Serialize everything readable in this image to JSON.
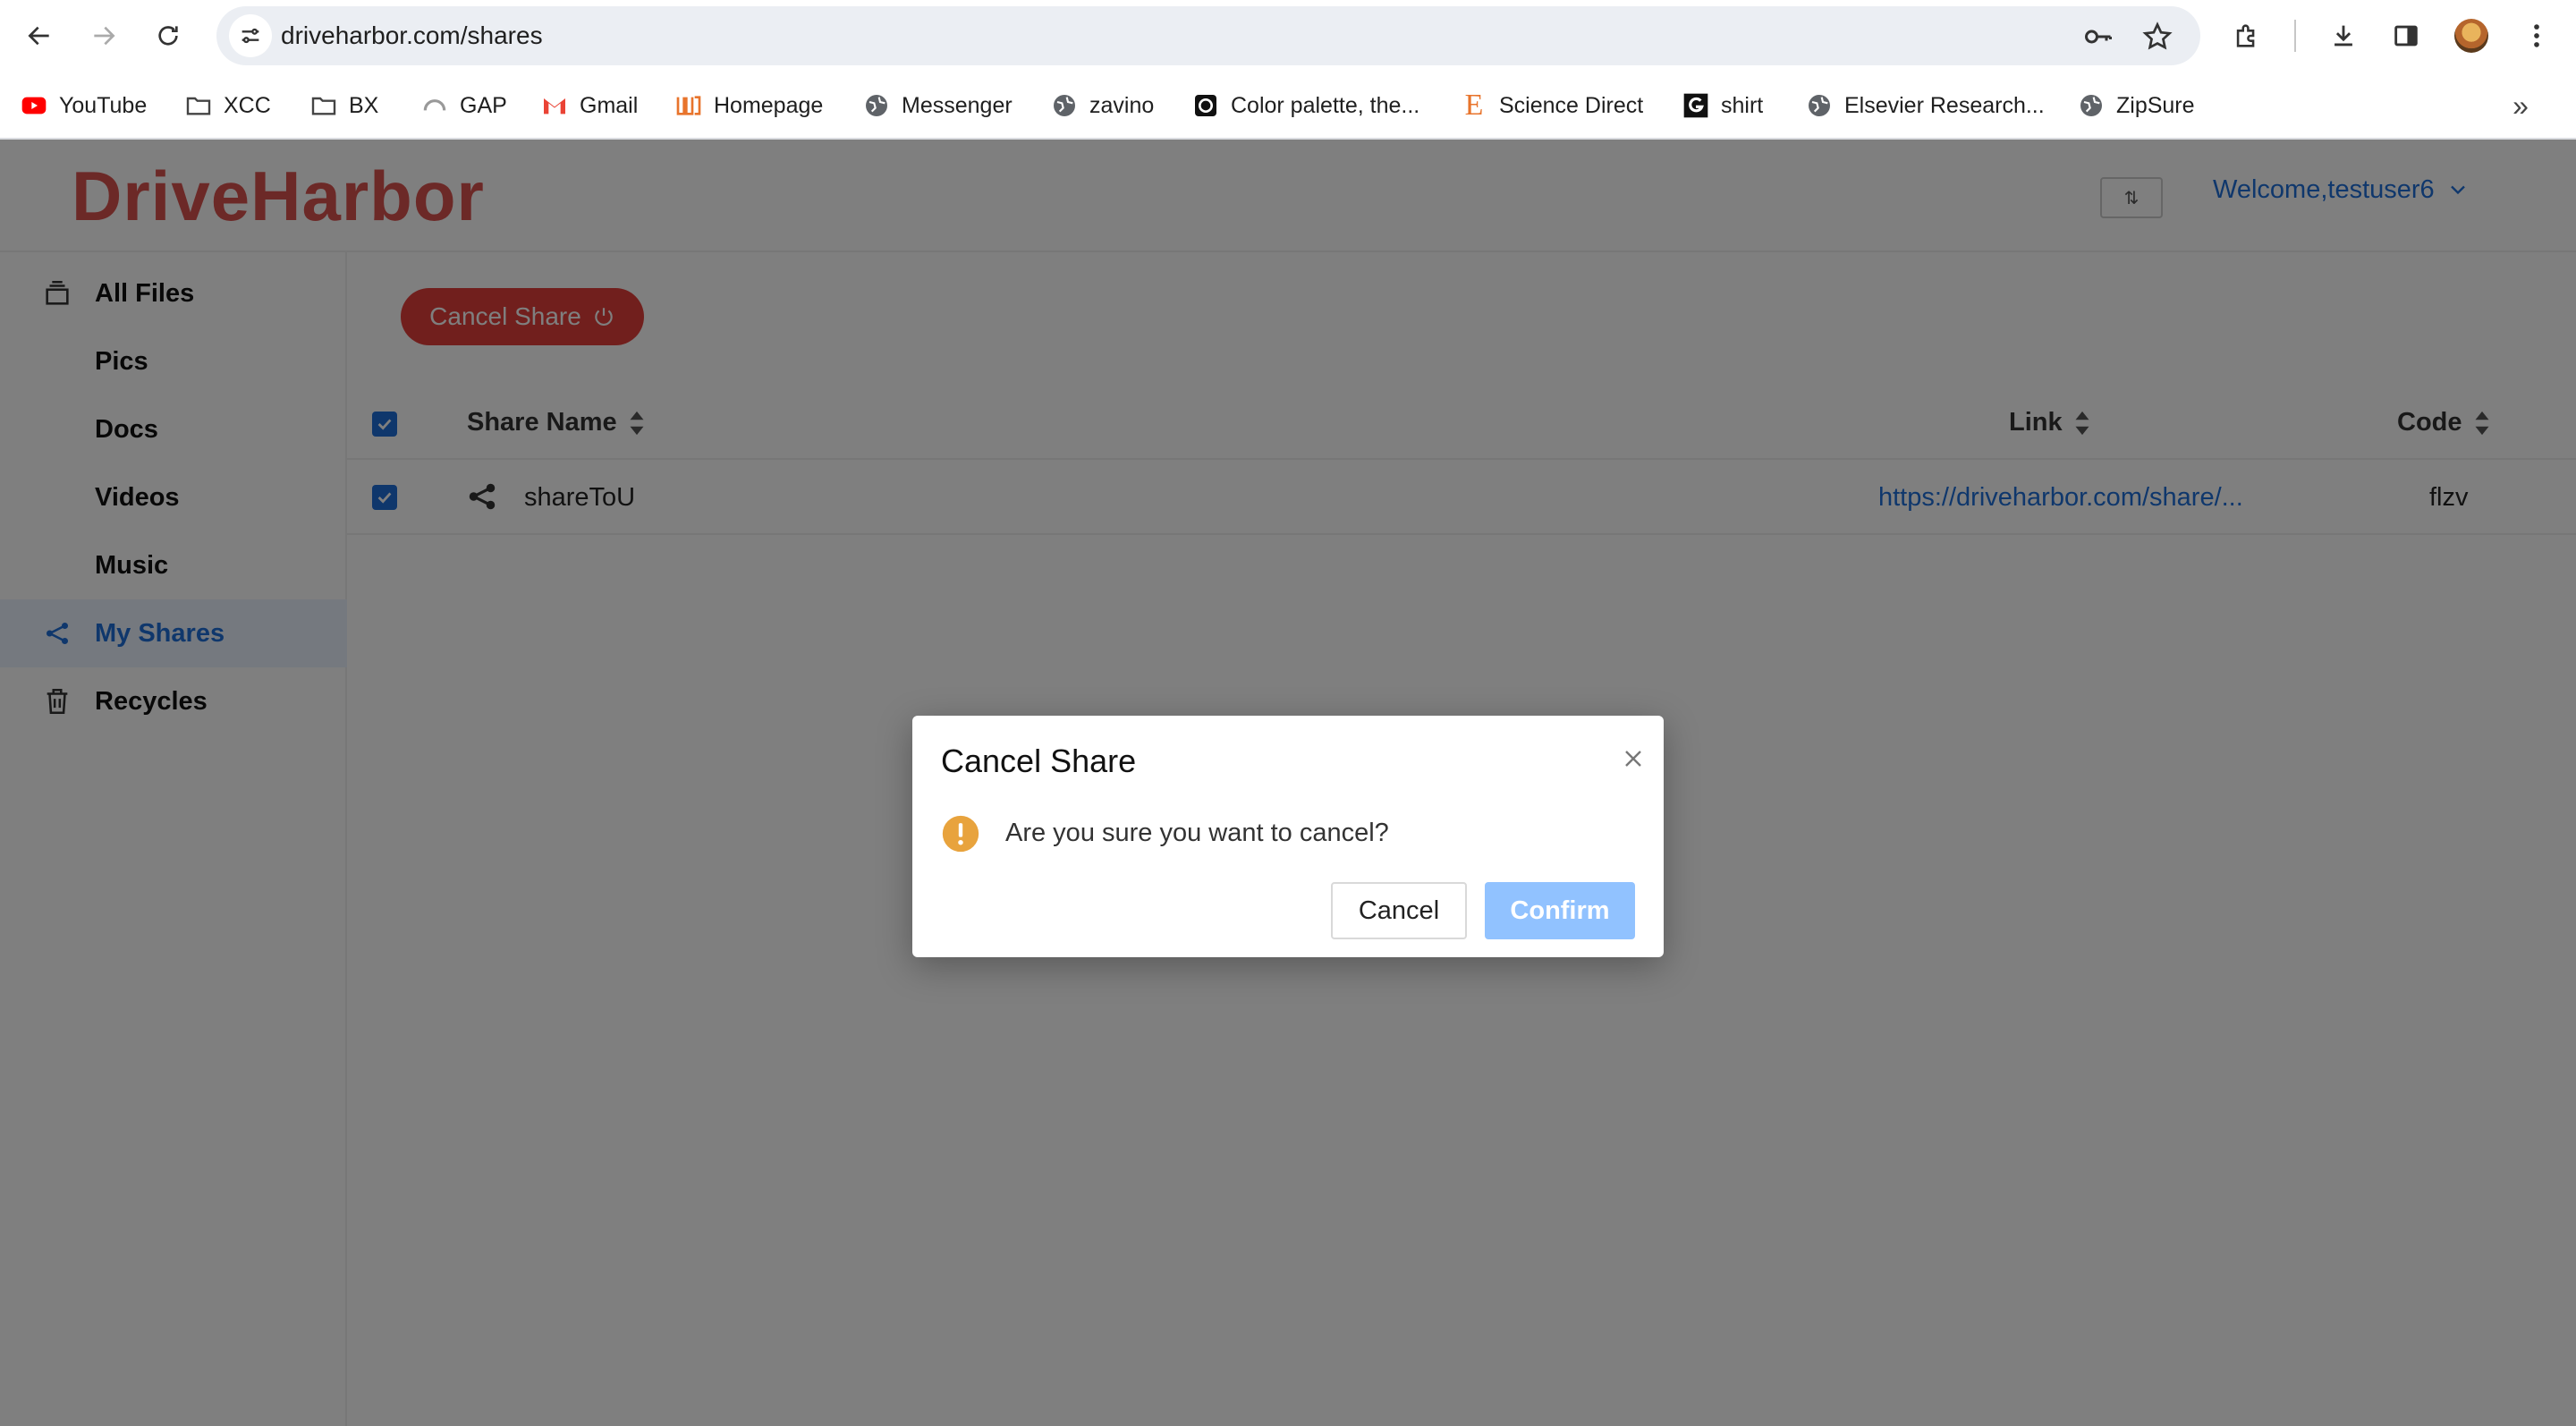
{
  "browser": {
    "url": "driveharbor.com/shares",
    "bookmarks": [
      {
        "label": "YouTube",
        "icon": "youtube-icon"
      },
      {
        "label": "XCC",
        "icon": "folder-icon"
      },
      {
        "label": "BX",
        "icon": "folder-icon"
      },
      {
        "label": "GAP",
        "icon": "gauge-icon"
      },
      {
        "label": "Gmail",
        "icon": "gmail-icon"
      },
      {
        "label": "Homepage",
        "icon": "homepage-icon"
      },
      {
        "label": "Messenger",
        "icon": "globe-icon"
      },
      {
        "label": "zavino",
        "icon": "globe-icon"
      },
      {
        "label": "Color palette, the...",
        "icon": "palette-icon"
      },
      {
        "label": "Science Direct",
        "icon": "elsevier-icon"
      },
      {
        "label": "shirt",
        "icon": "g-icon"
      },
      {
        "label": "Elsevier Research...",
        "icon": "globe-icon"
      },
      {
        "label": "ZipSure",
        "icon": "globe-icon"
      }
    ]
  },
  "app": {
    "brand": "DriveHarbor",
    "lang_toggle": "⇅",
    "welcome": "Welcome,testuser6",
    "accent": "#1e6fd9",
    "brand_color": "#d9534f"
  },
  "sidebar": {
    "items": [
      {
        "label": "All Files",
        "icon": "stack-icon"
      },
      {
        "label": "Pics",
        "icon": ""
      },
      {
        "label": "Docs",
        "icon": ""
      },
      {
        "label": "Videos",
        "icon": ""
      },
      {
        "label": "Music",
        "icon": ""
      },
      {
        "label": "My Shares",
        "icon": "share-icon",
        "active": true
      },
      {
        "label": "Recycles",
        "icon": "trash-icon"
      }
    ]
  },
  "main": {
    "cancel_share_label": "Cancel Share",
    "columns": [
      "Share Name",
      "Link",
      "Code"
    ],
    "rows": [
      {
        "name": "shareToU",
        "link": "https://driveharbor.com/share/...",
        "code": "flzv",
        "checked": true
      }
    ]
  },
  "modal": {
    "title": "Cancel Share",
    "message": "Are you sure you want to cancel?",
    "cancel_label": "Cancel",
    "confirm_label": "Confirm"
  }
}
